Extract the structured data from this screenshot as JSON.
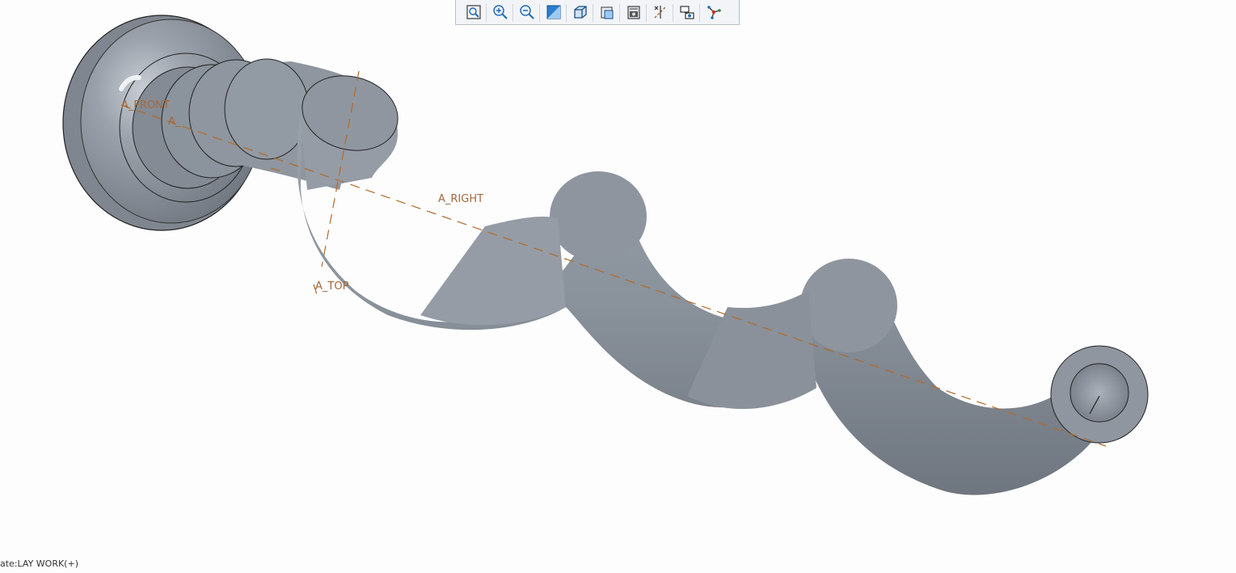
{
  "toolbar": {
    "buttons": [
      {
        "name": "refit-icon"
      },
      {
        "name": "zoom-in-icon"
      },
      {
        "name": "zoom-out-icon"
      },
      {
        "name": "repaint-icon"
      },
      {
        "name": "display-style-icon"
      },
      {
        "name": "saved-orientations-icon"
      },
      {
        "name": "view-manager-icon"
      },
      {
        "name": "datum-display-icon"
      },
      {
        "name": "annotation-display-icon"
      },
      {
        "name": "spin-center-icon"
      }
    ]
  },
  "model": {
    "axes": {
      "front": "A_FRONT",
      "partial": "A_",
      "right": "A_RIGHT",
      "top": "A_TOP"
    },
    "shade_color": "#8c939c",
    "axis_color": "#b06b2a"
  },
  "status": {
    "text": "ate:LAY WORK(+)"
  }
}
